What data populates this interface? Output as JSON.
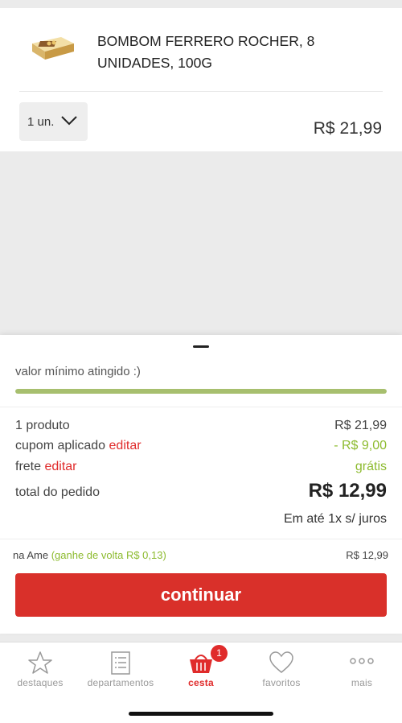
{
  "product": {
    "name": "BOMBOM FERRERO ROCHER, 8 UNIDADES, 100G",
    "quantity": "1 un.",
    "price": "R$ 21,99"
  },
  "summary": {
    "min_value_text": "valor mínimo atingido :)",
    "progress_fraction": 1.0,
    "rows": {
      "products_label": "1 produto",
      "products_value": "R$ 21,99",
      "coupon_label": "cupom aplicado",
      "coupon_edit": "editar",
      "coupon_value": "- R$ 9,00",
      "shipping_label": "frete",
      "shipping_edit": "editar",
      "shipping_value": "grátis"
    },
    "total_label": "total do pedido",
    "total_value": "R$ 12,99",
    "installments": "Em até 1x s/ juros",
    "ame": {
      "label": "na Ame",
      "cashback": "(ganhe de volta R$ 0,13)",
      "value": "R$ 12,99"
    },
    "continue_label": "continuar"
  },
  "tabbar": {
    "items": [
      {
        "label": "destaques",
        "icon": "star-icon"
      },
      {
        "label": "departamentos",
        "icon": "list-icon"
      },
      {
        "label": "cesta",
        "icon": "basket-icon",
        "badge": "1",
        "active": true
      },
      {
        "label": "favoritos",
        "icon": "heart-icon"
      },
      {
        "label": "mais",
        "icon": "more-icon"
      }
    ]
  },
  "colors": {
    "accent_red": "#d9302a",
    "green": "#8dbb2f",
    "progress": "#a7bf6e"
  }
}
